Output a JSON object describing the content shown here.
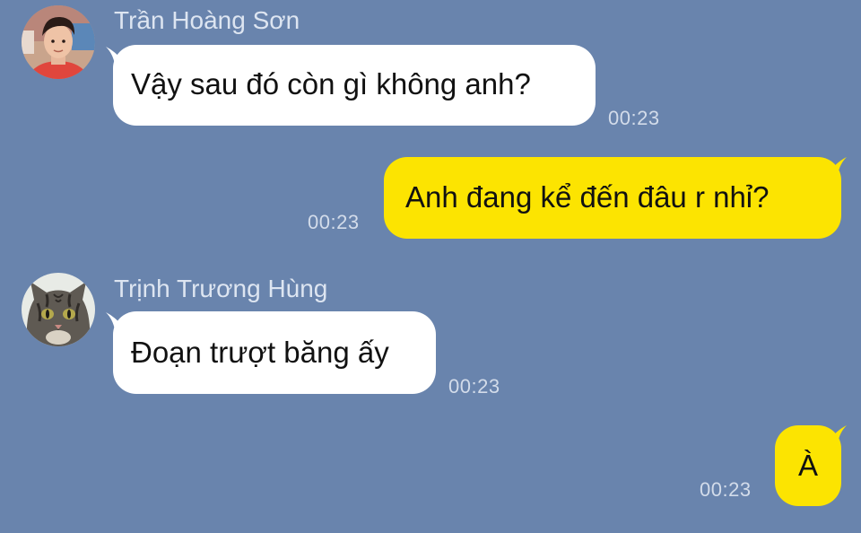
{
  "colors": {
    "background": "#6984ad",
    "incoming_bubble": "#ffffff",
    "outgoing_bubble": "#fce401",
    "name_text": "#dde5f1",
    "time_text": "#d3dcea"
  },
  "messages": [
    {
      "direction": "incoming",
      "sender": "Trần Hoàng Sơn",
      "avatar_icon": "person-photo-avatar",
      "text": "Vậy sau đó còn gì không anh?",
      "time": "00:23"
    },
    {
      "direction": "outgoing",
      "text": "Anh đang kể đến đâu r nhỉ?",
      "time": "00:23"
    },
    {
      "direction": "incoming",
      "sender": "Trịnh Trương Hùng",
      "avatar_icon": "cat-photo-avatar",
      "text": "Đoạn trượt băng ấy",
      "time": "00:23"
    },
    {
      "direction": "outgoing",
      "text": "À",
      "time": "00:23"
    }
  ]
}
